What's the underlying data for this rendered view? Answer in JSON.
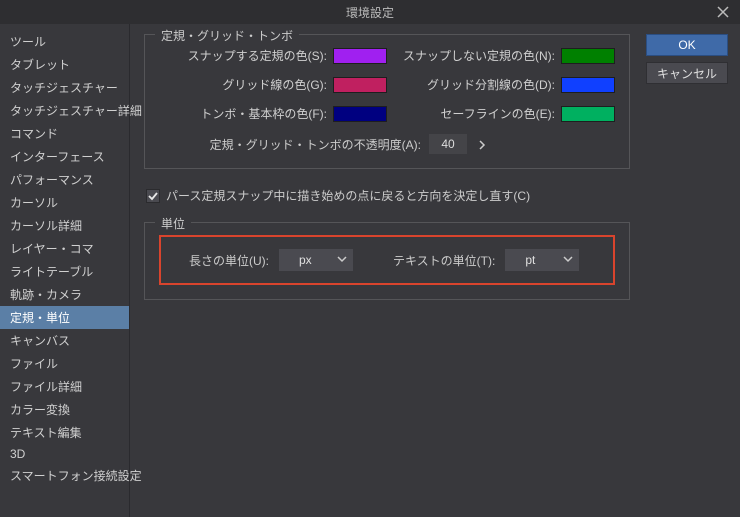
{
  "window": {
    "title": "環境設定"
  },
  "buttons": {
    "ok": "OK",
    "cancel": "キャンセル"
  },
  "sidebar": {
    "items": [
      {
        "label": "ツール"
      },
      {
        "label": "タブレット"
      },
      {
        "label": "タッチジェスチャー"
      },
      {
        "label": "タッチジェスチャー詳細"
      },
      {
        "label": "コマンド"
      },
      {
        "label": "インターフェース"
      },
      {
        "label": "パフォーマンス"
      },
      {
        "label": "カーソル"
      },
      {
        "label": "カーソル詳細"
      },
      {
        "label": "レイヤー・コマ"
      },
      {
        "label": "ライトテーブル"
      },
      {
        "label": "軌跡・カメラ"
      },
      {
        "label": "定規・単位"
      },
      {
        "label": "キャンバス"
      },
      {
        "label": "ファイル"
      },
      {
        "label": "ファイル詳細"
      },
      {
        "label": "カラー変換"
      },
      {
        "label": "テキスト編集"
      },
      {
        "label": "3D"
      },
      {
        "label": "スマートフォン接続設定"
      }
    ],
    "active_index": 12
  },
  "group1": {
    "legend": "定規・グリッド・トンボ",
    "snap_ruler_label": "スナップする定規の色(S):",
    "snap_ruler_color": "#a020f0",
    "nosnap_ruler_label": "スナップしない定規の色(N):",
    "nosnap_ruler_color": "#008000",
    "grid_line_label": "グリッド線の色(G):",
    "grid_line_color": "#c02060",
    "grid_div_label": "グリッド分割線の色(D):",
    "grid_div_color": "#1040ff",
    "tombo_label": "トンボ・基本枠の色(F):",
    "tombo_color": "#000080",
    "safeline_label": "セーフラインの色(E):",
    "safeline_color": "#00b060",
    "opacity_label": "定規・グリッド・トンボの不透明度(A):",
    "opacity_value": "40"
  },
  "checkbox": {
    "label": "パース定規スナップ中に描き始めの点に戻ると方向を決定し直す(C)",
    "checked": true
  },
  "group2": {
    "legend": "単位",
    "length_label": "長さの単位(U):",
    "length_value": "px",
    "text_label": "テキストの単位(T):",
    "text_value": "pt"
  }
}
